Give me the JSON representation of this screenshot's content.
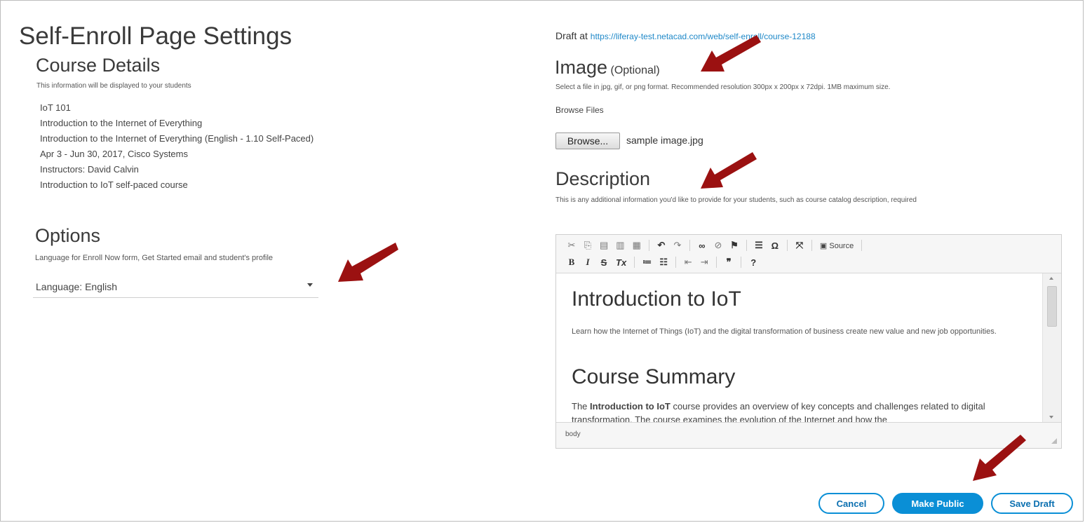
{
  "page_title": "Self-Enroll Page Settings",
  "course_details": {
    "heading": "Course Details",
    "note": "This information will be displayed to your students",
    "lines": [
      "IoT 101",
      "Introduction to the Internet of Everything",
      "Introduction to the Internet of Everything (English - 1.10 Self-Paced)",
      "Apr 3 - Jun 30, 2017, Cisco Systems",
      "Instructors: David Calvin",
      "Introduction to IoT self-paced course"
    ]
  },
  "options": {
    "heading": "Options",
    "note": "Language for Enroll Now form, Get Started email and student's profile",
    "language_select": "Language: English"
  },
  "draft": {
    "prefix": "Draft at",
    "url": "https://liferay-test.netacad.com/web/self-enroll/course-12188"
  },
  "image": {
    "heading": "Image",
    "optional": "(Optional)",
    "note": "Select a file in jpg, gif, or png format. Recommended resolution 300px x 200px x 72dpi. 1MB maximum size.",
    "browse_label": "Browse Files",
    "browse_button": "Browse...",
    "file_name": "sample image.jpg"
  },
  "description": {
    "heading": "Description",
    "note": "This is any additional information you'd like to provide for your students, such as course catalog description, required",
    "editor": {
      "source_label": "Source",
      "h1": "Introduction to IoT",
      "p1": "Learn how the Internet of Things (IoT) and the digital transformation of business create new value and new job opportunities.",
      "h2": "Course Summary",
      "p2_pre": "The ",
      "p2_bold": "Introduction to IoT",
      "p2_post": " course provides an overview of key concepts and challenges related to digital transformation. The course examines the evolution of the Internet and how the",
      "status_path": "body"
    }
  },
  "buttons": {
    "cancel": "Cancel",
    "make_public": "Make Public",
    "save_draft": "Save Draft"
  },
  "colors": {
    "accent": "#0a8fd6",
    "arrow": "#9b1111",
    "link": "#1e88c8"
  }
}
